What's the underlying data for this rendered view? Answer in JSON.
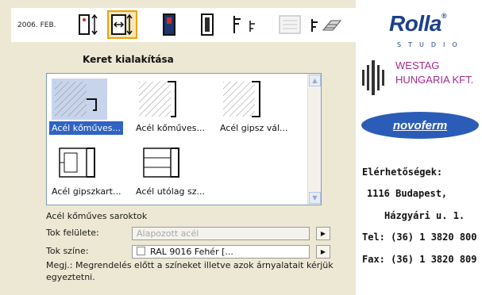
{
  "toolbar": {
    "date": "2006. FEB.",
    "buttons": [
      {
        "icon": "door-height-icon",
        "active": false
      },
      {
        "icon": "frame-width-icon",
        "active": true
      },
      {
        "icon": "door-leaf-icon",
        "active": false
      },
      {
        "icon": "door-panel-icon",
        "active": false
      },
      {
        "icon": "handle-icon",
        "active": false
      },
      {
        "icon": "list-icon",
        "active": false
      },
      {
        "icon": "accessories-icon",
        "active": false
      }
    ]
  },
  "brand": {
    "logo": "Rolla",
    "logo_mark": "®",
    "logo_sub": "STUDIO",
    "partner1_line1": "WESTAG",
    "partner1_line2": "HUNGARIA KFT.",
    "partner2": "novoferm",
    "contact_title": "Elérhetőségek:",
    "address_city": "1116 Budapest,",
    "address_street": "Házgyári u. 1.",
    "phone": "Tel:  (36) 1 3820 800",
    "fax": "Fax:  (36) 1 3820 809",
    "colors": {
      "rolla": "#1c3f8a",
      "westag": "#a32a8d",
      "novoferm": "#2b5db8"
    }
  },
  "main": {
    "title": "Keret kialakítása",
    "items": [
      {
        "label": "Acél kőműves...",
        "selected": true
      },
      {
        "label": "Acél kőműves...",
        "selected": false
      },
      {
        "label": "Acél gipsz vál...",
        "selected": false
      },
      {
        "label": "Acél gipszkart...",
        "selected": false
      },
      {
        "label": "Acél utólag sz...",
        "selected": false
      }
    ],
    "selected_name": "Acél kőműves saroktok",
    "surface_label": "Tok felülete:",
    "surface_value": "Alapozott acél",
    "color_label": "Tok színe:",
    "color_value": "RAL 9016 Fehér [...",
    "note": "Megj.: Megrendelés előtt a színeket illetve azok árnyalatait kérjük egyeztetni."
  }
}
